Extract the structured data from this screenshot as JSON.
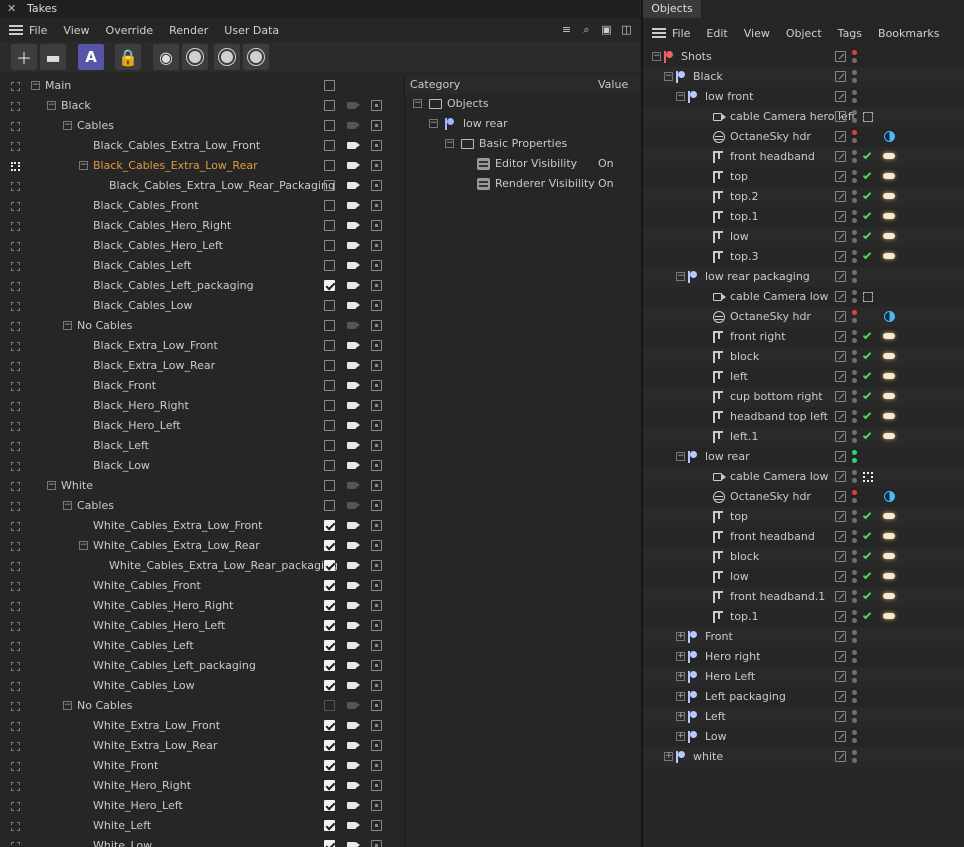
{
  "takes": {
    "tab_title": "Takes",
    "menu": [
      "File",
      "View",
      "Override",
      "Render",
      "User Data"
    ],
    "tree": [
      {
        "label": "Main",
        "depth": 0,
        "exp": "-",
        "checked": false,
        "cam": false,
        "rnd": false
      },
      {
        "label": "Black",
        "depth": 1,
        "exp": "-",
        "checked": false,
        "cam": "dim",
        "rnd": true
      },
      {
        "label": "Cables",
        "depth": 2,
        "exp": "-",
        "checked": false,
        "cam": "dim",
        "rnd": true
      },
      {
        "label": "Black_Cables_Extra_Low_Front",
        "depth": 3,
        "checked": false,
        "cam": true,
        "rnd": true
      },
      {
        "label": "Black_Cables_Extra_Low_Rear",
        "depth": 3,
        "exp": "-",
        "checked": false,
        "cam": true,
        "rnd": true,
        "active": true
      },
      {
        "label": "Black_Cables_Extra_Low_Rear_Packaging",
        "depth": 4,
        "checked": false,
        "cam": true,
        "rnd": true
      },
      {
        "label": "Black_Cables_Front",
        "depth": 3,
        "checked": false,
        "cam": true,
        "rnd": true
      },
      {
        "label": "Black_Cables_Hero_Right",
        "depth": 3,
        "checked": false,
        "cam": true,
        "rnd": true
      },
      {
        "label": "Black_Cables_Hero_Left",
        "depth": 3,
        "checked": false,
        "cam": true,
        "rnd": true
      },
      {
        "label": "Black_Cables_Left",
        "depth": 3,
        "checked": false,
        "cam": true,
        "rnd": true
      },
      {
        "label": "Black_Cables_Left_packaging",
        "depth": 3,
        "checked": true,
        "cam": true,
        "rnd": true
      },
      {
        "label": "Black_Cables_Low",
        "depth": 3,
        "checked": false,
        "cam": true,
        "rnd": true
      },
      {
        "label": "No Cables",
        "depth": 2,
        "exp": "-",
        "checked": false,
        "cam": "dim",
        "rnd": true
      },
      {
        "label": "Black_Extra_Low_Front",
        "depth": 3,
        "checked": false,
        "cam": true,
        "rnd": true
      },
      {
        "label": "Black_Extra_Low_Rear",
        "depth": 3,
        "checked": false,
        "cam": true,
        "rnd": true
      },
      {
        "label": "Black_Front",
        "depth": 3,
        "checked": false,
        "cam": true,
        "rnd": true
      },
      {
        "label": "Black_Hero_Right",
        "depth": 3,
        "checked": false,
        "cam": true,
        "rnd": true
      },
      {
        "label": "Black_Hero_Left",
        "depth": 3,
        "checked": false,
        "cam": true,
        "rnd": true
      },
      {
        "label": "Black_Left",
        "depth": 3,
        "checked": false,
        "cam": true,
        "rnd": true
      },
      {
        "label": "Black_Low",
        "depth": 3,
        "checked": false,
        "cam": true,
        "rnd": true
      },
      {
        "label": "White",
        "depth": 1,
        "exp": "-",
        "checked": false,
        "cam": "dim",
        "rnd": true
      },
      {
        "label": "Cables",
        "depth": 2,
        "exp": "-",
        "checked": false,
        "cam": "dim",
        "rnd": true
      },
      {
        "label": "White_Cables_Extra_Low_Front",
        "depth": 3,
        "checked": true,
        "cam": true,
        "rnd": true
      },
      {
        "label": "White_Cables_Extra_Low_Rear",
        "depth": 3,
        "exp": "-",
        "checked": true,
        "cam": true,
        "rnd": true
      },
      {
        "label": "White_Cables_Extra_Low_Rear_packaging",
        "depth": 4,
        "checked": true,
        "cam": true,
        "rnd": true
      },
      {
        "label": "White_Cables_Front",
        "depth": 3,
        "checked": true,
        "cam": true,
        "rnd": true
      },
      {
        "label": "White_Cables_Hero_Right",
        "depth": 3,
        "checked": true,
        "cam": true,
        "rnd": true
      },
      {
        "label": "White_Cables_Hero_Left",
        "depth": 3,
        "checked": true,
        "cam": true,
        "rnd": true
      },
      {
        "label": "White_Cables_Left",
        "depth": 3,
        "checked": true,
        "cam": true,
        "rnd": true
      },
      {
        "label": "White_Cables_Left_packaging",
        "depth": 3,
        "checked": true,
        "cam": true,
        "rnd": true
      },
      {
        "label": "White_Cables_Low",
        "depth": 3,
        "checked": true,
        "cam": true,
        "rnd": true
      },
      {
        "label": "No Cables",
        "depth": 2,
        "exp": "-",
        "checked": "dis",
        "cam": "dim",
        "rnd": true
      },
      {
        "label": "White_Extra_Low_Front",
        "depth": 3,
        "checked": true,
        "cam": true,
        "rnd": true
      },
      {
        "label": "White_Extra_Low_Rear",
        "depth": 3,
        "checked": true,
        "cam": true,
        "rnd": true
      },
      {
        "label": "White_Front",
        "depth": 3,
        "checked": true,
        "cam": true,
        "rnd": true
      },
      {
        "label": "White_Hero_Right",
        "depth": 3,
        "checked": true,
        "cam": true,
        "rnd": true
      },
      {
        "label": "White_Hero_Left",
        "depth": 3,
        "checked": true,
        "cam": true,
        "rnd": true
      },
      {
        "label": "White_Left",
        "depth": 3,
        "checked": true,
        "cam": true,
        "rnd": true
      },
      {
        "label": "White_Low",
        "depth": 3,
        "checked": true,
        "cam": true,
        "rnd": true
      }
    ],
    "category": {
      "col_category": "Category",
      "col_value": "Value",
      "rows": [
        {
          "label": "Objects",
          "depth": 0,
          "icon": "folder",
          "value": ""
        },
        {
          "label": "low rear",
          "depth": 1,
          "icon": "shot",
          "value": ""
        },
        {
          "label": "Basic Properties",
          "depth": 2,
          "icon": "folder",
          "value": ""
        },
        {
          "label": "Editor Visibility",
          "depth": 3,
          "icon": "toggle",
          "value": "On"
        },
        {
          "label": "Renderer Visibility",
          "depth": 3,
          "icon": "toggle",
          "value": "On"
        }
      ]
    }
  },
  "objects": {
    "tab_title": "Objects",
    "menu": [
      "File",
      "Edit",
      "View",
      "Object",
      "Tags",
      "Bookmarks"
    ],
    "rows": [
      {
        "label": "Shots",
        "depth": 0,
        "icon": "shot-red",
        "exp": "-",
        "d1": "r",
        "d2": "g0"
      },
      {
        "label": "Black",
        "depth": 1,
        "icon": "shot",
        "exp": "-",
        "d1": "n",
        "d2": "n"
      },
      {
        "label": "low front",
        "depth": 2,
        "icon": "shot",
        "exp": "-",
        "d1": "n",
        "d2": "n"
      },
      {
        "label": "cable Camera hero left",
        "depth": 3,
        "icon": "cam",
        "d1": "n",
        "d2": "n",
        "tag": "dsq"
      },
      {
        "label": "OctaneSky hdr",
        "depth": 3,
        "icon": "sky",
        "d1": "r",
        "d2": "n",
        "tag": "half"
      },
      {
        "label": "front headband",
        "depth": 3,
        "icon": "light",
        "d1": "n",
        "d2": "n",
        "tick": true,
        "tag": "pill"
      },
      {
        "label": "top",
        "depth": 3,
        "icon": "light",
        "d1": "n",
        "d2": "n",
        "tick": true,
        "tag": "pill"
      },
      {
        "label": "top.2",
        "depth": 3,
        "icon": "light",
        "d1": "n",
        "d2": "n",
        "tick": true,
        "tag": "pill"
      },
      {
        "label": "top.1",
        "depth": 3,
        "icon": "light",
        "d1": "n",
        "d2": "n",
        "tick": true,
        "tag": "pill"
      },
      {
        "label": "low",
        "depth": 3,
        "icon": "light",
        "d1": "n",
        "d2": "n",
        "tick": true,
        "tag": "pill"
      },
      {
        "label": "top.3",
        "depth": 3,
        "icon": "light",
        "d1": "n",
        "d2": "n",
        "tick": true,
        "tag": "pill"
      },
      {
        "label": "low rear packaging",
        "depth": 2,
        "icon": "shot",
        "exp": "-",
        "d1": "n",
        "d2": "n"
      },
      {
        "label": "cable Camera low",
        "depth": 3,
        "icon": "cam",
        "d1": "n",
        "d2": "n",
        "tag": "dsq"
      },
      {
        "label": "OctaneSky hdr",
        "depth": 3,
        "icon": "sky",
        "d1": "r",
        "d2": "n",
        "tag": "half"
      },
      {
        "label": "front right",
        "depth": 3,
        "icon": "light",
        "d1": "n",
        "d2": "n",
        "tick": true,
        "tag": "pill"
      },
      {
        "label": "block",
        "depth": 3,
        "icon": "light",
        "d1": "n",
        "d2": "n",
        "tick": true,
        "tag": "pill"
      },
      {
        "label": "left",
        "depth": 3,
        "icon": "light",
        "d1": "n",
        "d2": "n",
        "tick": true,
        "tag": "pill"
      },
      {
        "label": "cup bottom right",
        "depth": 3,
        "icon": "light",
        "d1": "n",
        "d2": "n",
        "tick": true,
        "tag": "pill"
      },
      {
        "label": "headband top left",
        "depth": 3,
        "icon": "light",
        "d1": "n",
        "d2": "n",
        "tick": true,
        "tag": "pill"
      },
      {
        "label": "left.1",
        "depth": 3,
        "icon": "light",
        "d1": "n",
        "d2": "n",
        "tick": true,
        "tag": "pill"
      },
      {
        "label": "low rear",
        "depth": 2,
        "icon": "shot",
        "exp": "-",
        "d1": "g",
        "d2": "g"
      },
      {
        "label": "cable Camera low",
        "depth": 3,
        "icon": "cam",
        "d1": "n",
        "d2": "n",
        "tag": "dsq-act"
      },
      {
        "label": "OctaneSky hdr",
        "depth": 3,
        "icon": "sky",
        "d1": "r",
        "d2": "n",
        "tag": "half"
      },
      {
        "label": "top",
        "depth": 3,
        "icon": "light",
        "d1": "n",
        "d2": "n",
        "tick": true,
        "tag": "pill"
      },
      {
        "label": "front headband",
        "depth": 3,
        "icon": "light",
        "d1": "n",
        "d2": "n",
        "tick": true,
        "tag": "pill"
      },
      {
        "label": "block",
        "depth": 3,
        "icon": "light",
        "d1": "n",
        "d2": "n",
        "tick": true,
        "tag": "pill"
      },
      {
        "label": "low",
        "depth": 3,
        "icon": "light",
        "d1": "n",
        "d2": "n",
        "tick": true,
        "tag": "pill"
      },
      {
        "label": "front headband.1",
        "depth": 3,
        "icon": "light",
        "d1": "n",
        "d2": "n",
        "tick": true,
        "tag": "pill"
      },
      {
        "label": "top.1",
        "depth": 3,
        "icon": "light",
        "d1": "n",
        "d2": "n",
        "tick": true,
        "tag": "pill"
      },
      {
        "label": "Front",
        "depth": 2,
        "icon": "shot",
        "exp": "+",
        "d1": "n",
        "d2": "n"
      },
      {
        "label": "Hero right",
        "depth": 2,
        "icon": "shot",
        "exp": "+",
        "d1": "n",
        "d2": "n"
      },
      {
        "label": "Hero Left",
        "depth": 2,
        "icon": "shot",
        "exp": "+",
        "d1": "n",
        "d2": "n"
      },
      {
        "label": "Left packaging",
        "depth": 2,
        "icon": "shot",
        "exp": "+",
        "d1": "n",
        "d2": "n"
      },
      {
        "label": "Left",
        "depth": 2,
        "icon": "shot",
        "exp": "+",
        "d1": "n",
        "d2": "n"
      },
      {
        "label": "Low",
        "depth": 2,
        "icon": "shot",
        "exp": "+",
        "d1": "n",
        "d2": "n"
      },
      {
        "label": "white",
        "depth": 1,
        "icon": "shot",
        "exp": "+",
        "d1": "n",
        "d2": "n"
      }
    ]
  }
}
